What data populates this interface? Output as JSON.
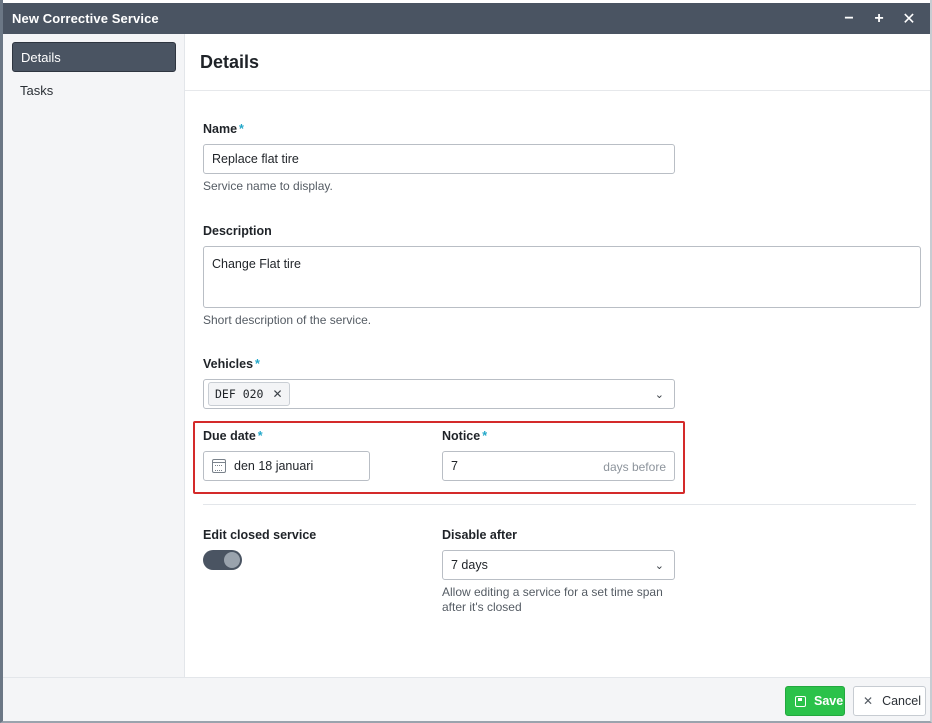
{
  "window": {
    "title": "New Corrective Service",
    "controls": {
      "minimize": "−",
      "maximize": "+",
      "close": "✕"
    }
  },
  "sidebar": {
    "items": [
      {
        "label": "Details",
        "active": true
      },
      {
        "label": "Tasks",
        "active": false
      }
    ]
  },
  "main": {
    "title": "Details",
    "name": {
      "label": "Name",
      "required": "*",
      "value": "Replace flat tire",
      "help": "Service name to display."
    },
    "description": {
      "label": "Description",
      "value": "Change Flat tire",
      "help": "Short description of the service."
    },
    "vehicles": {
      "label": "Vehicles",
      "required": "*",
      "chips": [
        {
          "label": "DEF 020"
        }
      ],
      "chip_remove": "✕",
      "dropdown_icon": "chevron-down-icon",
      "chevron": "⌄"
    },
    "due_date": {
      "label": "Due date",
      "required": "*",
      "value": "den 18 januari",
      "icon": "calendar-icon"
    },
    "notice": {
      "label": "Notice",
      "required": "*",
      "value": "7",
      "suffix": "days before"
    },
    "edit_closed": {
      "label": "Edit closed service",
      "enabled": true
    },
    "disable_after": {
      "label": "Disable after",
      "selected": "7 days",
      "chevron": "⌄",
      "help_line1": "Allow editing a service for a set time span",
      "help_line2": "after it's closed"
    }
  },
  "footer": {
    "save_label": "Save",
    "cancel_label": "Cancel",
    "cancel_icon": "✕"
  },
  "colors": {
    "titlebar": "#4a5462",
    "accent_required": "#22a7c9",
    "highlight_box": "#d42a2a",
    "save_button": "#2bc24a"
  }
}
